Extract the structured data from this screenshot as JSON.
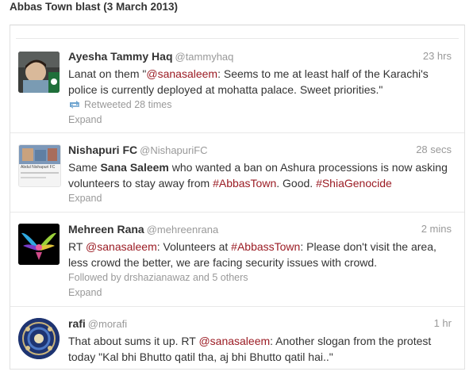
{
  "caption": "Abbas Town blast (3 March 2013)",
  "colors": {
    "link": "#9b1c24",
    "muted": "#999999",
    "border": "#e1e1e1"
  },
  "tweets": [
    {
      "avatar_icon": "child-avatar-icon",
      "fullname": "Ayesha Tammy Haq",
      "handle": "@tammyhaq",
      "time": "23 hrs",
      "text_parts": [
        "Lanat on them \"",
        "@sanasaleem",
        ": Seems to me at least half of the Karachi's police is currently deployed at mohatta palace. Sweet priorities.\""
      ],
      "meta": "Retweeted 28 times",
      "expand": "Expand"
    },
    {
      "avatar_icon": "profile-banner-avatar-icon",
      "avatar_caption": "Abdul Nishapuri FC",
      "fullname": "Nishapuri FC",
      "handle": "@NishapuriFC",
      "time": "28 secs",
      "text_parts": [
        "Same ",
        "Sana Saleem",
        " who wanted a ban on Ashura processions is now asking volunteers to stay away from ",
        "#AbbasTown",
        ". Good. ",
        "#ShiaGenocide"
      ],
      "expand": "Expand"
    },
    {
      "avatar_icon": "glowing-wings-avatar-icon",
      "fullname": "Mehreen Rana",
      "handle": "@mehreenrana",
      "time": "2 mins",
      "text_parts": [
        "RT ",
        "@sanasaleem",
        ": Volunteers at ",
        "#AbbassTown",
        ": Please don't visit the area, less crowd the better, we are facing security issues with crowd."
      ],
      "meta": "Followed by drshazianawaz and 5 others",
      "expand": "Expand"
    },
    {
      "avatar_icon": "mosaic-dome-avatar-icon",
      "fullname": "rafi",
      "handle": "@morafi",
      "time": "1 hr",
      "text_parts": [
        "That about sums it up. RT ",
        "@sanasaleem",
        ": Another slogan from the protest today \"Kal bhi Bhutto qatil tha, aj bhi Bhutto qatil hai..\""
      ]
    }
  ]
}
